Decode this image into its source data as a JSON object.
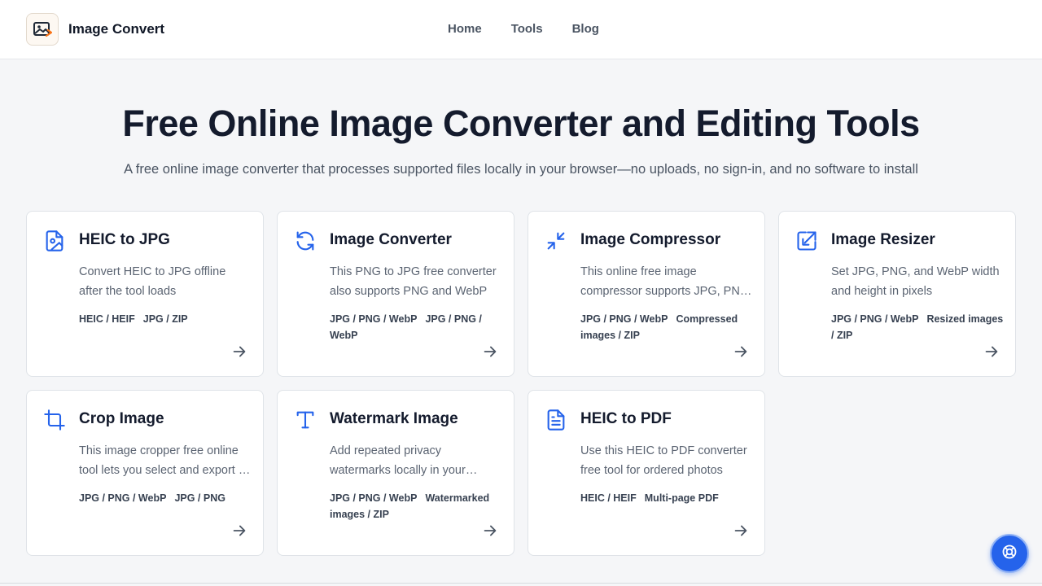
{
  "header": {
    "brand": "Image Convert",
    "nav": [
      "Home",
      "Tools",
      "Blog"
    ]
  },
  "hero": {
    "title": "Free Online Image Converter and Editing Tools",
    "subtitle": "A free online image converter that processes supported files locally in your browser—no uploads, no sign-in, and no software to install"
  },
  "cards": [
    {
      "title": "HEIC to JPG",
      "icon": "image-file-icon",
      "description": "Convert HEIC to JPG offline after the tool loads",
      "input": "HEIC / HEIF",
      "output": "JPG / ZIP"
    },
    {
      "title": "Image Converter",
      "icon": "refresh-icon",
      "description": "This PNG to JPG free converter also supports PNG and WebP",
      "input": "JPG / PNG / WebP",
      "output": "JPG / PNG / WebP"
    },
    {
      "title": "Image Compressor",
      "icon": "compress-icon",
      "description": "This online free image compressor supports JPG, PNG, and WebP",
      "input": "JPG / PNG / WebP",
      "output": "Compressed images / ZIP"
    },
    {
      "title": "Image Resizer",
      "icon": "resize-icon",
      "description": "Set JPG, PNG, and WebP width and height in pixels",
      "input": "JPG / PNG / WebP",
      "output": "Resized images / ZIP"
    },
    {
      "title": "Crop Image",
      "icon": "crop-icon",
      "description": "This image cropper free online tool lets you select and export a crop area",
      "input": "JPG / PNG / WebP",
      "output": "JPG / PNG"
    },
    {
      "title": "Watermark Image",
      "icon": "text-icon",
      "description": "Add repeated privacy watermarks locally in your browser",
      "input": "JPG / PNG / WebP",
      "output": "Watermarked images / ZIP"
    },
    {
      "title": "HEIC to PDF",
      "icon": "document-icon",
      "description": "Use this HEIC to PDF converter free tool for ordered photos",
      "input": "HEIC / HEIF",
      "output": "Multi-page PDF"
    }
  ],
  "colors": {
    "accent": "#2563eb",
    "background": "#f5f6f8",
    "card": "#ffffff"
  }
}
